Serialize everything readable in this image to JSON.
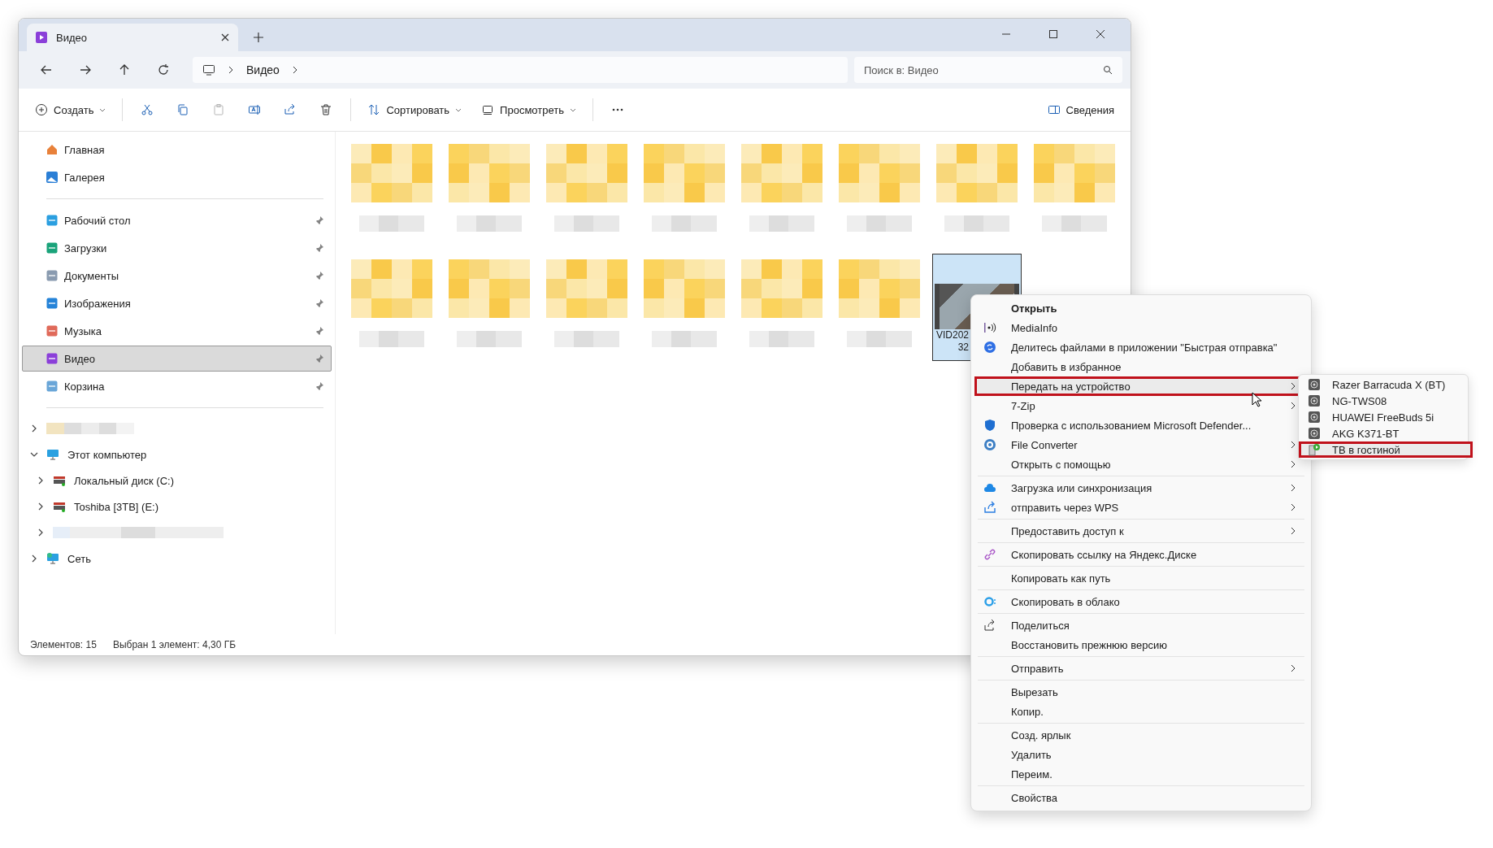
{
  "window": {
    "tabs": [
      {
        "title": "Видео",
        "selected": true
      }
    ]
  },
  "address": {
    "crumbs": [
      "Видео"
    ],
    "search_placeholder": "Поиск в: Видео"
  },
  "toolbar": {
    "items": [
      {
        "kind": "menu",
        "label": "Создать",
        "disabled": false
      },
      {
        "kind": "icon",
        "disabled": false
      },
      {
        "kind": "icon",
        "disabled": false
      },
      {
        "kind": "icon",
        "disabled": true
      },
      {
        "kind": "icon",
        "disabled": false
      },
      {
        "kind": "icon",
        "disabled": false
      },
      {
        "kind": "icon",
        "disabled": false
      },
      {
        "kind": "menu",
        "label": "Сортировать",
        "disabled": false
      },
      {
        "kind": "menu",
        "label": "Просмотреть",
        "disabled": false
      },
      {
        "kind": "more",
        "disabled": false
      }
    ],
    "details": "Сведения"
  },
  "sidebar": {
    "top": [
      {
        "label": "Главная",
        "pinned": false,
        "selected": false
      },
      {
        "label": "Галерея",
        "pinned": false,
        "selected": false
      }
    ],
    "quick": [
      {
        "label": "Рабочий стол",
        "pinned": true,
        "selected": false
      },
      {
        "label": "Загрузки",
        "pinned": true,
        "selected": false
      },
      {
        "label": "Документы",
        "pinned": true,
        "selected": false
      },
      {
        "label": "Изображения",
        "pinned": true,
        "selected": false
      },
      {
        "label": "Музыка",
        "pinned": true,
        "selected": false
      },
      {
        "label": "Видео",
        "pinned": true,
        "selected": true
      },
      {
        "label": "Корзина",
        "pinned": true,
        "selected": false
      }
    ],
    "tree": [
      {
        "kind": "blurred",
        "expanded": false
      },
      {
        "kind": "computer",
        "label": "Этот компьютер",
        "expanded": true,
        "children": [
          {
            "kind": "drive",
            "label": "Локальный диск (C:)",
            "expanded": false
          },
          {
            "kind": "drive",
            "label": "Toshiba [3TB] (E:)",
            "expanded": false
          },
          {
            "kind": "blurred",
            "expanded": false
          }
        ]
      },
      {
        "kind": "network",
        "label": "Сеть",
        "expanded": false
      }
    ]
  },
  "files": [
    {
      "kind": "blurred",
      "selected": false
    },
    {
      "kind": "blurred",
      "selected": false
    },
    {
      "kind": "blurred",
      "selected": false
    },
    {
      "kind": "blurred",
      "selected": false
    },
    {
      "kind": "blurred",
      "selected": false
    },
    {
      "kind": "blurred",
      "selected": false
    },
    {
      "kind": "blurred",
      "selected": false
    },
    {
      "kind": "blurred",
      "selected": false
    },
    {
      "kind": "blurred",
      "selected": false
    },
    {
      "kind": "blurred",
      "selected": false
    },
    {
      "kind": "blurred",
      "selected": false
    },
    {
      "kind": "blurred",
      "selected": false
    },
    {
      "kind": "blurred",
      "selected": false
    },
    {
      "kind": "blurred",
      "selected": false
    },
    {
      "kind": "video",
      "name": [
        "VID202",
        "32"
      ],
      "selected": true
    }
  ],
  "status_bar": {
    "count": "Элементов: 15",
    "selection": "Выбран 1 элемент: 4,30 ГБ"
  },
  "context_menu": {
    "groups": [
      [
        {
          "label": "Открыть",
          "bold": true,
          "submenu": false,
          "selected": false
        },
        {
          "label": "MediaInfo",
          "bold": false,
          "submenu": false,
          "selected": false
        },
        {
          "label": "Делитесь файлами в приложении \"Быстрая отправка\"",
          "bold": false,
          "submenu": false,
          "selected": false
        },
        {
          "label": "Добавить в избранное",
          "bold": false,
          "submenu": false,
          "selected": false
        },
        {
          "label": "Передать на устройство",
          "bold": false,
          "submenu": true,
          "selected": true
        },
        {
          "label": "7-Zip",
          "bold": false,
          "submenu": true,
          "selected": false
        },
        {
          "label": "Проверка с использованием Microsoft Defender...",
          "bold": false,
          "submenu": false,
          "selected": false
        },
        {
          "label": "File Converter",
          "bold": false,
          "submenu": true,
          "selected": false
        },
        {
          "label": "Открыть с помощью",
          "bold": false,
          "submenu": true,
          "selected": false
        }
      ],
      [
        {
          "label": "Загрузка или синхронизация",
          "bold": false,
          "submenu": true,
          "selected": false
        },
        {
          "label": "отправить через WPS",
          "bold": false,
          "submenu": true,
          "selected": false
        }
      ],
      [
        {
          "label": "Предоставить доступ к",
          "bold": false,
          "submenu": true,
          "selected": false
        }
      ],
      [
        {
          "label": "Скопировать ссылку на Яндекс.Диске",
          "bold": false,
          "submenu": false,
          "selected": false
        }
      ],
      [
        {
          "label": "Копировать как путь",
          "bold": false,
          "submenu": false,
          "selected": false
        }
      ],
      [
        {
          "label": "Скопировать в облако",
          "bold": false,
          "submenu": false,
          "selected": false
        }
      ],
      [
        {
          "label": "Поделиться",
          "bold": false,
          "submenu": false,
          "selected": false
        },
        {
          "label": "Восстановить прежнюю версию",
          "bold": false,
          "submenu": false,
          "selected": false
        }
      ],
      [
        {
          "label": "Отправить",
          "bold": false,
          "submenu": true,
          "selected": false
        }
      ],
      [
        {
          "label": "Вырезать",
          "bold": false,
          "submenu": false,
          "selected": false
        },
        {
          "label": "Копир.",
          "bold": false,
          "submenu": false,
          "selected": false
        }
      ],
      [
        {
          "label": "Созд. ярлык",
          "bold": false,
          "submenu": false,
          "selected": false
        },
        {
          "label": "Удалить",
          "bold": false,
          "submenu": false,
          "selected": false
        },
        {
          "label": "Переим.",
          "bold": false,
          "submenu": false,
          "selected": false
        }
      ],
      [
        {
          "label": "Свойства",
          "bold": false,
          "submenu": false,
          "selected": false
        }
      ]
    ]
  },
  "submenu": {
    "items": [
      {
        "kind": "speaker",
        "label": "Razer Barracuda X (BT)",
        "selected": false
      },
      {
        "kind": "speaker",
        "label": "NG-TWS08",
        "selected": false
      },
      {
        "kind": "speaker",
        "label": "HUAWEI FreeBuds 5i",
        "selected": false
      },
      {
        "kind": "speaker",
        "label": "AKG K371-BT",
        "selected": false
      },
      {
        "kind": "tv",
        "label": "ТВ в гостиной",
        "selected": true
      }
    ]
  }
}
